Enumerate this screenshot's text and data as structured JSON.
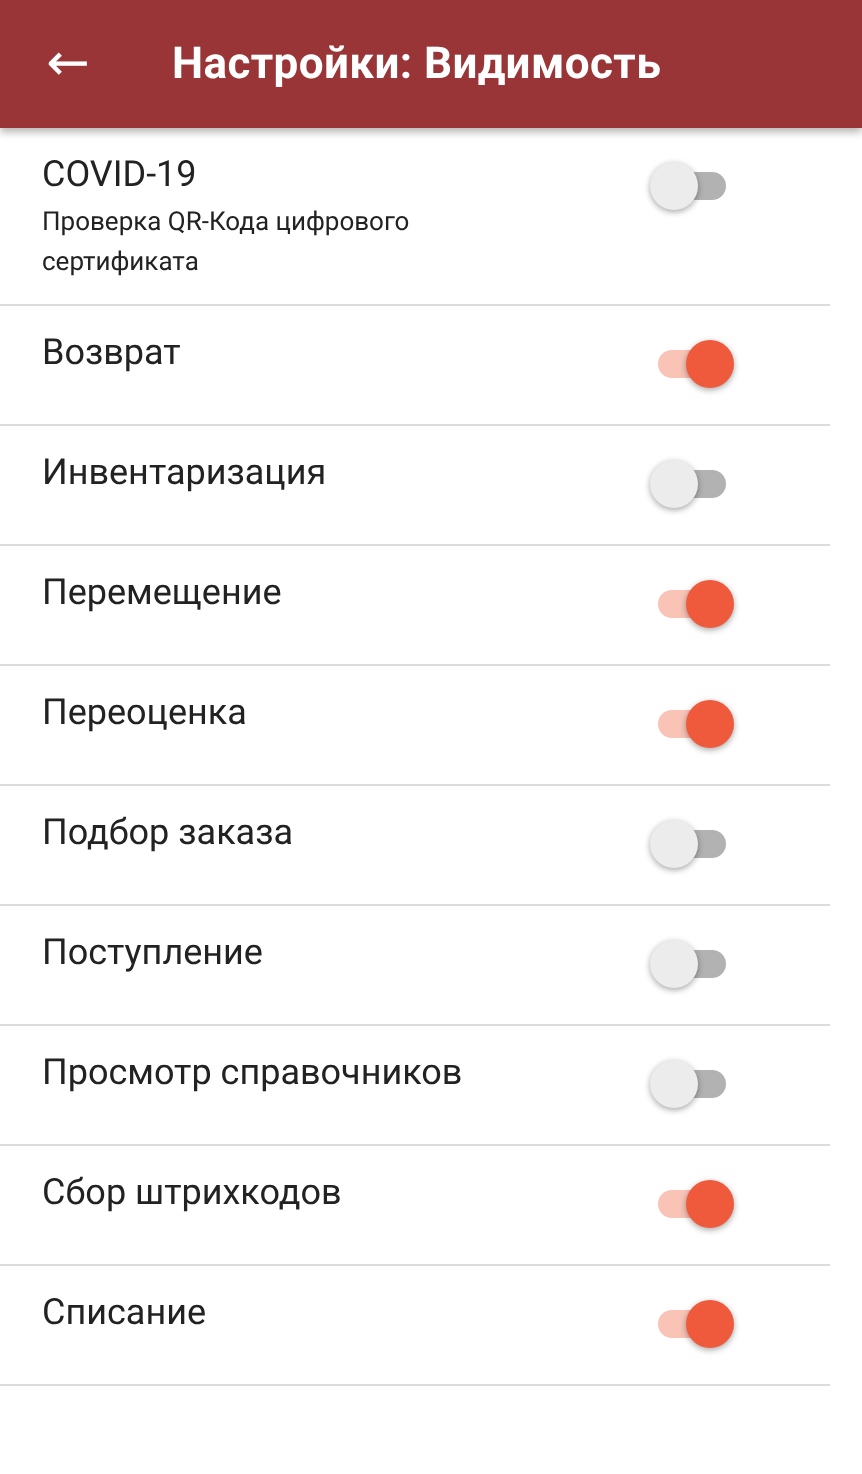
{
  "app_bar": {
    "back": "←",
    "title": "Настройки: Видимость"
  },
  "settings": [
    {
      "label": "COVID-19",
      "subtitle": "Проверка QR-Кода цифрового сертификата",
      "on": false
    },
    {
      "label": "Возврат",
      "on": true
    },
    {
      "label": "Инвентаризация",
      "on": false
    },
    {
      "label": "Перемещение",
      "on": true
    },
    {
      "label": "Переоценка",
      "on": true
    },
    {
      "label": "Подбор заказа",
      "on": false
    },
    {
      "label": "Поступление",
      "on": false
    },
    {
      "label": "Просмотр справочников",
      "on": false
    },
    {
      "label": "Сбор штрихкодов",
      "on": true
    },
    {
      "label": "Списание",
      "on": true
    }
  ]
}
